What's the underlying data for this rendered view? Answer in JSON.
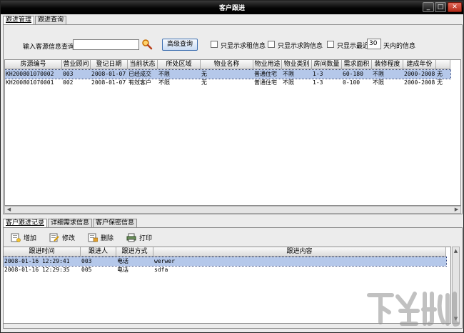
{
  "window": {
    "title": "客户跟进",
    "min": "_",
    "max": "□",
    "close": "✕"
  },
  "top_tabs": [
    "跟进管理",
    "跟进查询"
  ],
  "search": {
    "label": "输入客源信息查询",
    "value": "",
    "advanced_button": "高级查询",
    "filters": [
      "只显示求租信息",
      "只显示求购信息",
      "只显示最近"
    ],
    "days_value": "30",
    "days_suffix": "天内的信息"
  },
  "properties_table": {
    "columns": [
      "房源编号",
      "营业顾问",
      "登记日期",
      "当前状态",
      "所处区域",
      "物业名称",
      "物业用途",
      "物业类别",
      "房间数量",
      "需求面积",
      "装修程度",
      "建成年份",
      ""
    ],
    "rows": [
      [
        "KH200801070002",
        "003",
        "2008-01-07",
        "已经成交",
        "不限",
        "无",
        "普通住宅",
        "不限",
        "1-3",
        "60-180",
        "不限",
        "2000-2008",
        "无"
      ],
      [
        "KH200801070001",
        "002",
        "2008-01-07",
        "有效客户",
        "不限",
        "无",
        "普通住宅",
        "不限",
        "1-3",
        "0-100",
        "不限",
        "2000-2008",
        "无"
      ]
    ],
    "selected_row": 0
  },
  "bottom_tabs": [
    "客户跟进记录",
    "详细需求信息",
    "客户保密信息"
  ],
  "toolbar": {
    "add": "增加",
    "edit": "修改",
    "delete": "删除",
    "print": "打印"
  },
  "followup_table": {
    "columns": [
      "跟进时间",
      "跟进人",
      "跟进方式",
      "跟进内容"
    ],
    "rows": [
      [
        "2008-01-16 12:29:41",
        "003",
        "电话",
        "werwer"
      ],
      [
        "2008-01-16 12:29:35",
        "005",
        "电话",
        "sdfa"
      ]
    ],
    "selected_row": 0
  },
  "colors": {
    "selection": "#b5c8ea",
    "titlebar": "#000000",
    "watermark": "#8f8f8f"
  }
}
